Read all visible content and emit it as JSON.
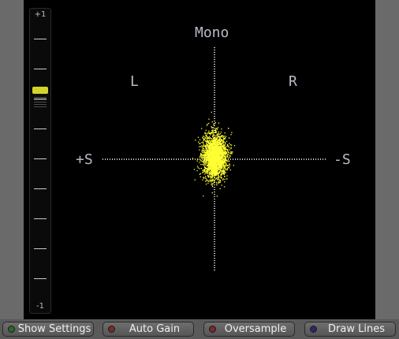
{
  "meter": {
    "top_label": "+1",
    "bottom_label": "-1",
    "level": 0.5
  },
  "scope": {
    "label_top": "Mono",
    "label_left_channel": "L",
    "label_right_channel": "R",
    "label_left_side": "+S",
    "label_right_side": "-S",
    "dot_color": "#ffff33",
    "axis_color": "#c8ccd4",
    "text_color": "#b8bcc8"
  },
  "buttons": [
    {
      "label": "Show Settings",
      "led_color": "#2a6a2a"
    },
    {
      "label": "Auto Gain",
      "led_color": "#7a2a2a"
    },
    {
      "label": "Oversample",
      "led_color": "#7a2a2a"
    },
    {
      "label": "Draw Lines",
      "led_color": "#2a2a6a"
    }
  ]
}
